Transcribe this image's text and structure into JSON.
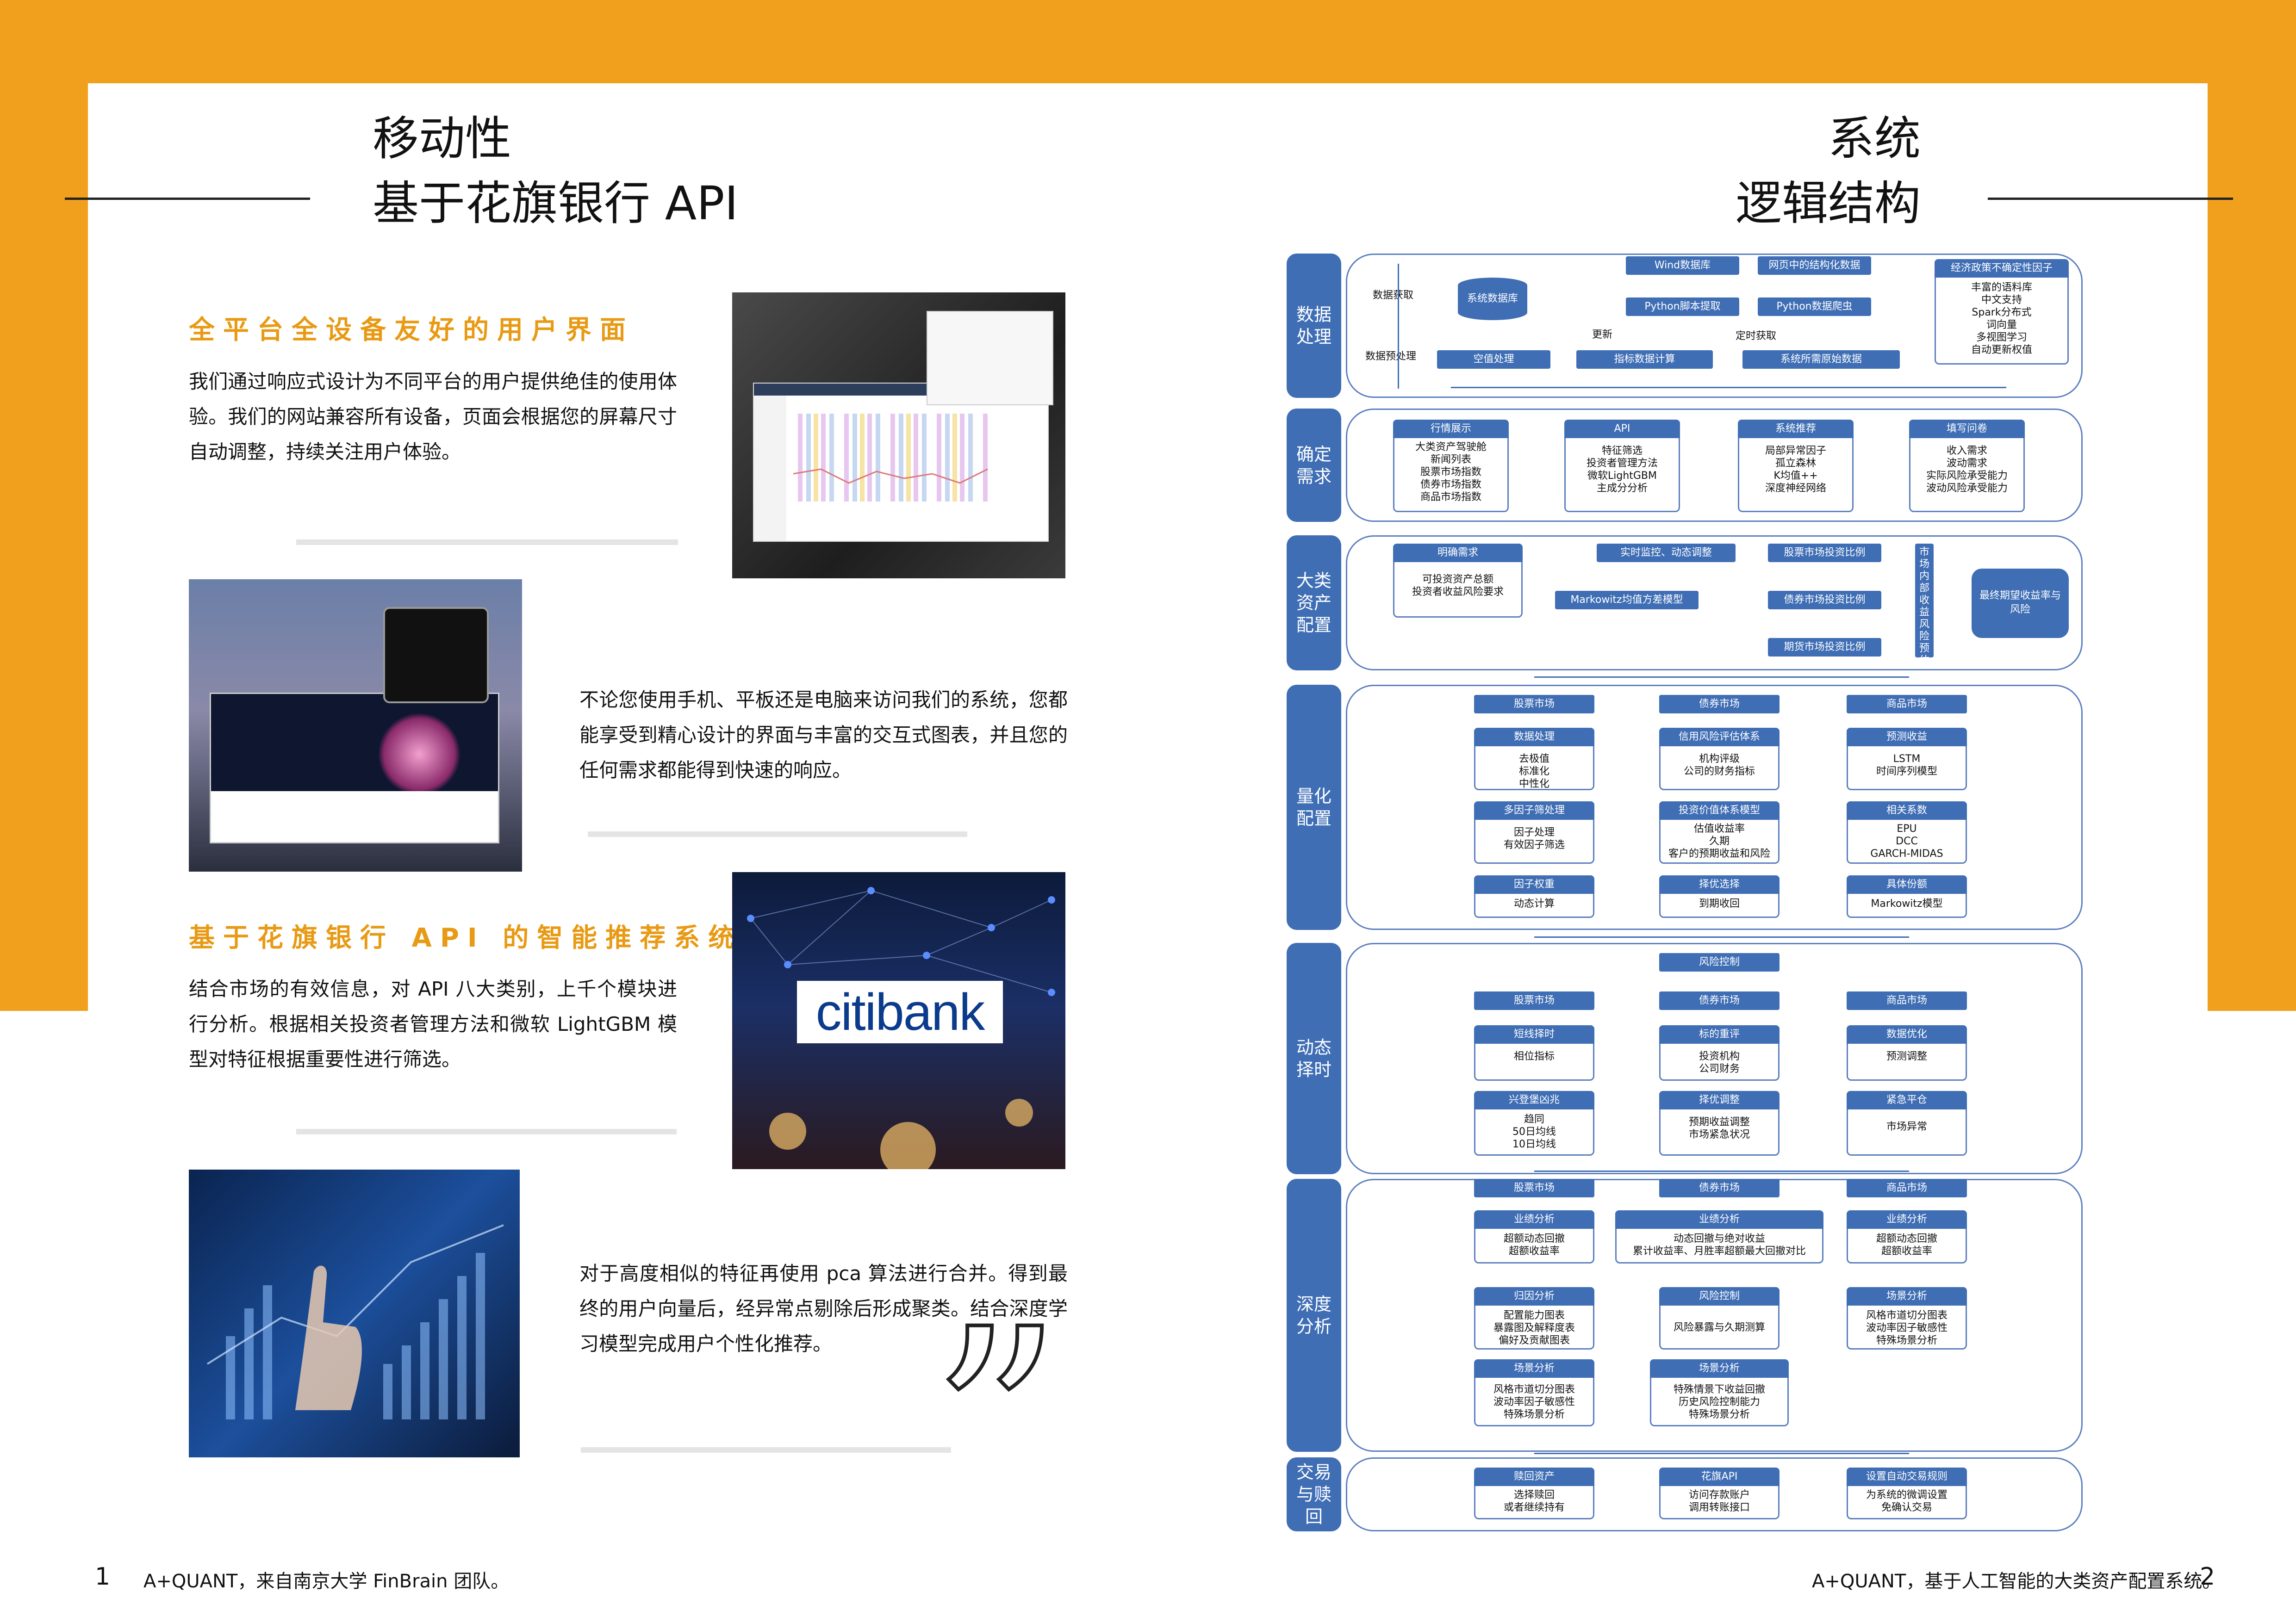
{
  "left": {
    "title_line1": "移动性",
    "title_line2": "基于花旗银行 API",
    "section1": {
      "heading": "全平台全设备友好的用户界面",
      "para": "我们通过响应式设计为不同平台的用户提供绝佳的使用体验。我们的网站兼容所有设备，页面会根据您的屏幕尺寸自动调整，持续关注用户体验。"
    },
    "para2": "不论您使用手机、平板还是电脑来访问我们的系统，您都能享受到精心设计的界面与丰富的交互式图表，并且您的任何需求都能得到快速的响应。",
    "section2": {
      "heading": "基于花旗银行 API 的智能推荐系统",
      "para": "结合市场的有效信息，对 API 八大类别，上千个模块进行分析。根据相关投资者管理方法和微软 LightGBM 模型对特征根据重要性进行筛选。"
    },
    "para3": "对于高度相似的特征再使用 pca 算法进行合并。得到最终的用户向量后，经异常点剔除后形成聚类。结合深度学习模型完成用户个性化推荐。",
    "logo_text": "citibank",
    "footer": "A+QUANT，来自南京大学 FinBrain 团队。",
    "page_number": "1"
  },
  "right": {
    "title_line1": "系统",
    "title_line2": "逻辑结构",
    "footer": "A+QUANT，基于人工智能的大类资产配置系统。",
    "page_number": "2"
  },
  "flow": {
    "lane1": {
      "label": "数据处理",
      "db": "系统数据库",
      "wind": "Wind数据库",
      "web": "网页中的结构化数据",
      "macro": "经济政策不确定性因子",
      "py_extract": "Python脚本提取",
      "py_crawl": "Python数据爬虫",
      "macro_body": "丰富的语料库\n中文支持\nSpark分布式\n词向量\n多视图学习\n自动更新权值",
      "missing": "空值处理",
      "indicator": "指标数据计算",
      "raw": "系统所需原始数据",
      "t_get": "数据获取",
      "t_pre": "数据预处理",
      "t_update": "更新",
      "t_timed": "定时获取"
    },
    "lane2": {
      "label": "确定需求",
      "cards": [
        {
          "hd": "行情展示",
          "bd": "大类资产驾驶舱\n新闻列表\n股票市场指数\n债券市场指数\n商品市场指数"
        },
        {
          "hd": "API",
          "bd": "特征筛选\n投资者管理方法\n微软LightGBM\n主成分分析"
        },
        {
          "hd": "系统推荐",
          "bd": "局部异常因子\n孤立森林\nK均值++\n深度神经网络"
        },
        {
          "hd": "填写问卷",
          "bd": "收入需求\n波动需求\n实际风险承受能力\n波动风险承受能力"
        }
      ]
    },
    "lane3": {
      "label": "大类资产配置",
      "need_hd": "明确需求",
      "need_bd": "可投资资产总额\n投资者收益风险要求",
      "monitor": "实时监控、动态调整",
      "markowitz": "Markowitz均值方差模型",
      "stock": "股票市场投资比例",
      "bond": "债券市场投资比例",
      "futures": "期货市场投资比例",
      "predict": "市场内部收益风险预估",
      "final": "最终期望收益率与风险"
    },
    "lane4": {
      "label": "量化配置",
      "markets": [
        "股票市场",
        "债券市场",
        "商品市场"
      ],
      "cards": [
        {
          "hd": "数据处理",
          "bd": "去极值\n标准化\n中性化"
        },
        {
          "hd": "信用风险评估体系",
          "bd": "机构评级\n公司的财务指标"
        },
        {
          "hd": "预测收益",
          "bd": "LSTM\n时间序列模型"
        },
        {
          "hd": "多因子筛处理",
          "bd": "因子处理\n有效因子筛选"
        },
        {
          "hd": "投资价值体系模型",
          "bd": "估值收益率\n久期\n客户的预期收益和风险"
        },
        {
          "hd": "相关系数",
          "bd": "EPU\nDCC\nGARCH-MIDAS"
        },
        {
          "hd": "因子权重",
          "bd": "动态计算"
        },
        {
          "hd": "择优选择",
          "bd": "到期收回"
        },
        {
          "hd": "具体份额",
          "bd": "Markowitz模型"
        }
      ]
    },
    "lane5": {
      "label": "动态择时",
      "risk": "风险控制",
      "markets": [
        "股票市场",
        "债券市场",
        "商品市场"
      ],
      "cards": [
        {
          "hd": "短线择时",
          "bd": "相位指标"
        },
        {
          "hd": "标的重评",
          "bd": "投资机构\n公司财务"
        },
        {
          "hd": "数据优化",
          "bd": "预测调整"
        },
        {
          "hd": "兴登堡凶兆",
          "bd": "趋同\n50日均线\n10日均线"
        },
        {
          "hd": "择优调整",
          "bd": "预期收益调整\n市场紧急状况"
        },
        {
          "hd": "紧急平仓",
          "bd": "市场异常"
        }
      ]
    },
    "lane6": {
      "label": "深度分析",
      "markets": [
        "股票市场",
        "债券市场",
        "商品市场"
      ],
      "cards": [
        {
          "hd": "业绩分析",
          "bd": "超额动态回撤\n超额收益率"
        },
        {
          "hd": "业绩分析",
          "bd": "动态回撤与绝对收益\n累计收益率、月胜率超额最大回撤对比"
        },
        {
          "hd": "业绩分析",
          "bd": "超额动态回撤\n超额收益率"
        },
        {
          "hd": "归因分析",
          "bd": "配置能力图表\n暴露图及解释度表\n偏好及贡献图表"
        },
        {
          "hd": "风险控制",
          "bd": "风险暴露与久期测算"
        },
        {
          "hd": "场景分析",
          "bd": "风格市道切分图表\n波动率因子敏感性\n特殊场景分析"
        },
        {
          "hd": "场景分析",
          "bd": "风格市道切分图表\n波动率因子敏感性\n特殊场景分析"
        },
        {
          "hd": "场景分析",
          "bd": "特殊情景下收益回撤\n历史风险控制能力\n特殊场景分析"
        }
      ]
    },
    "lane7": {
      "label": "交易与赎回",
      "cards": [
        {
          "hd": "赎回资产",
          "bd": "选择赎回\n或者继续持有"
        },
        {
          "hd": "花旗API",
          "bd": "访问存款账户\n调用转账接口"
        },
        {
          "hd": "设置自动交易规则",
          "bd": "为系统的微调设置\n免确认交易"
        }
      ]
    }
  },
  "colors": {
    "accent": "#F0A01C",
    "flow_blue": "#3F6EB5",
    "heading_orange": "#E89A14"
  }
}
